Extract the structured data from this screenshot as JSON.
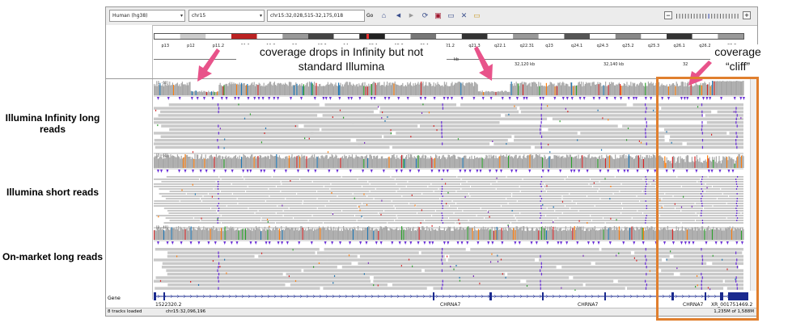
{
  "toolbar": {
    "genome": "Human (hg38)",
    "chromosome": "chr15",
    "locus": "chr15:32,028,515-32,175,018",
    "go": "Go"
  },
  "ideogram_bands": [
    "p13",
    "p12",
    "p11.2",
    "p11.1",
    "q11.2",
    "q12",
    "q13.2",
    "q14",
    "q15.1",
    "q15.3",
    "q21.1",
    "q21.2",
    "q21.3",
    "q22.1",
    "q22.31",
    "q23",
    "q24.1",
    "q24.3",
    "q25.2",
    "q25.3",
    "q26.1",
    "q26.2",
    "q26.3"
  ],
  "ruler": {
    "unit": "kb",
    "ticks": [
      "32,120 kb",
      "32,140 kb",
      "32"
    ]
  },
  "tracks": [
    {
      "label": "Illumina Infinity long reads",
      "range": "[0 - 60]"
    },
    {
      "label": "Illumina short reads",
      "range": "[0 - 60]"
    },
    {
      "label": "On-market long reads",
      "range": "[0 - 40]"
    }
  ],
  "gene_track": {
    "label": "Gene",
    "genes": [
      "1522320.2",
      "CHRNA7",
      "CHRNA7",
      "CHRNA7",
      "XR_001751469.2"
    ]
  },
  "status": {
    "tracks_loaded": "8 tracks loaded",
    "position": "chr15:32,096,196",
    "memory": "1,235M of 1,588M"
  },
  "annotations": {
    "left_callout": "coverage drops in Infinity but not standard Illumina",
    "right_callout_line1": "coverage",
    "right_callout_line2": "“cliff”"
  },
  "colors": {
    "arrow": "#e8538a",
    "highlight": "#e07f2e",
    "insertion": "#6a2fd8",
    "read": "#c9c9c9",
    "coverage": "#a8a8a8"
  }
}
